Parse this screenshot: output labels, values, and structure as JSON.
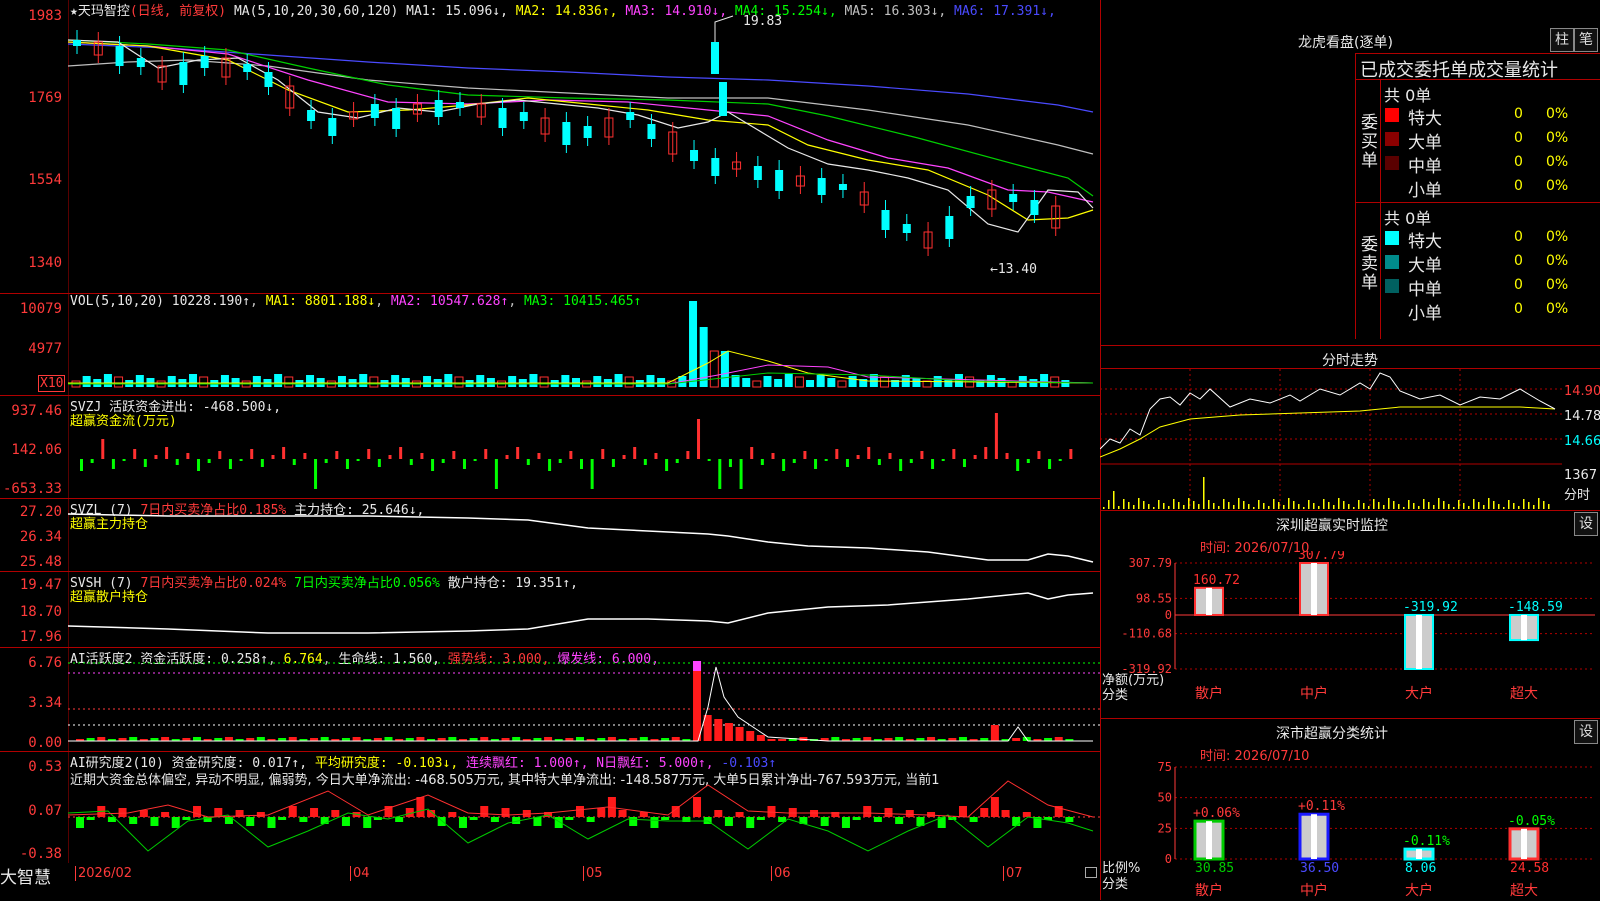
{
  "main": {
    "title_stock": "★天玛智控",
    "title_period": "(日线, 前复权)",
    "ma_label": "MA(5,10,20,30,60,120)",
    "ma_values": [
      {
        "name": "MA1",
        "value": "15.096↓",
        "color": "#e8e8e8"
      },
      {
        "name": "MA2",
        "value": "14.836↑",
        "color": "#ffff00"
      },
      {
        "name": "MA3",
        "value": "14.910↓",
        "color": "#ff44ff"
      },
      {
        "name": "MA4",
        "value": "15.254↓",
        "color": "#00ff00"
      },
      {
        "name": "MA5",
        "value": "16.303↓",
        "color": "#c0c0c0"
      },
      {
        "name": "MA6",
        "value": "17.391↓",
        "color": "#4a4aff"
      }
    ],
    "y_ticks": [
      "1983",
      "1769",
      "1554",
      "1340"
    ],
    "high_label": "19.83",
    "low_label": "←13.40"
  },
  "vol": {
    "label": "VOL(5,10,20)",
    "value": "10228.190↑",
    "ma1": "MA1: 8801.188↓",
    "ma2": "MA2: 10547.628↑",
    "ma3": "MA3: 10415.465↑",
    "y_ticks": [
      "10079",
      "4977"
    ],
    "unit": "X10"
  },
  "svzj": {
    "label": "SVZJ 活跃资金进出: -468.500↓,",
    "sub": "超赢资金流(万元)",
    "y_ticks": [
      "937.46",
      "142.06",
      "-653.33"
    ]
  },
  "svzl": {
    "label": "SVZL (7)",
    "part2": "7日内买卖净占比0.185%",
    "part3": "主力持仓: 25.646↓,",
    "sub": "超赢主力持仓",
    "y_ticks": [
      "27.20",
      "26.34",
      "25.48"
    ]
  },
  "svsh": {
    "label": "SVSH (7)",
    "part2": "7日内买卖净占比0.024%",
    "part3": "7日内买卖净占比0.056%",
    "part4": "散户持仓: 19.351↑,",
    "sub": "超赢散户持仓",
    "y_ticks": [
      "19.47",
      "18.70",
      "17.96"
    ]
  },
  "ai1": {
    "label": "AI活跃度2 资金活跃度: 0.258↑",
    "v2": "6.764",
    "v3": "生命线: 1.560,",
    "v4": "强势线: 3.000,",
    "v5": "爆发线: 6.000,",
    "y_ticks": [
      "6.76",
      "3.34",
      "0.00"
    ]
  },
  "ai2": {
    "label": "AI研究度2(10) 资金研究度: 0.017↑,",
    "v2": "平均研究度: -0.103↓,",
    "v3": "连续飘红: 1.000↑,",
    "v4": "N日飘红: 5.000↑,",
    "v5": "-0.103↑",
    "note": "近期大资金总体偏空, 异动不明显, 偏弱势, 今日大单净流出: -468.505万元, 其中特大单净流出: -148.587万元, 大单5日累计净出-767.593万元, 当前1",
    "y_ticks": [
      "0.53",
      "0.07",
      "-0.38"
    ]
  },
  "footer": {
    "brand": "大智慧",
    "dates": [
      "2026/02",
      "04",
      "05",
      "06",
      "07"
    ]
  },
  "right": {
    "dragon_title": "龙虎看盘(逐单)",
    "btn_bar": "柱",
    "btn_pen": "笔",
    "stats_title": "已成交委托单成交量统计",
    "buy_label": "委买单",
    "sell_label": "委卖单",
    "buy_total": "共 0单",
    "sell_total": "共 0单",
    "buy_rows": [
      {
        "name": "特大",
        "count": "0",
        "pct": "0%",
        "color": "#ff0000"
      },
      {
        "name": "大单",
        "count": "0",
        "pct": "0%",
        "color": "#8b0000"
      },
      {
        "name": "中单",
        "count": "0",
        "pct": "0%",
        "color": "#5a0000"
      },
      {
        "name": "小单",
        "count": "0",
        "pct": "0%",
        "color": "#000000"
      }
    ],
    "sell_rows": [
      {
        "name": "特大",
        "count": "0",
        "pct": "0%",
        "color": "#00ffff"
      },
      {
        "name": "大单",
        "count": "0",
        "pct": "0%",
        "color": "#008b8b"
      },
      {
        "name": "中单",
        "count": "0",
        "pct": "0%",
        "color": "#006060"
      },
      {
        "name": "小单",
        "count": "0",
        "pct": "0%",
        "color": "#000000"
      }
    ],
    "intraday_title": "分时走势",
    "intraday_ticks": [
      "14.90",
      "14.78",
      "14.66"
    ],
    "intraday_vol": "1367",
    "intraday_unit": "分时",
    "sz_title": "深圳超赢实时监控",
    "sz_btn": "设",
    "sz_time": "时间: 2026/07/10",
    "sz_ylabel": "净额(万元)",
    "sz_xlabel": "分类",
    "sz_ticks": [
      "307.79",
      "98.55",
      "0",
      "-110.68",
      "-319.92"
    ],
    "class_title": "深市超赢分类统计",
    "class_btn": "设",
    "class_time": "时间: 2026/07/10",
    "class_ylabel": "比例%",
    "class_xlabel": "分类",
    "class_ticks": [
      "75",
      "50",
      "25",
      "0"
    ]
  },
  "chart_data": [
    {
      "type": "bar",
      "title": "深圳超赢实时监控",
      "categories": [
        "散户",
        "中户",
        "大户",
        "超大"
      ],
      "values": [
        160.72,
        307.79,
        -319.92,
        -148.59
      ],
      "ylabel": "净额(万元)",
      "xlabel": "分类",
      "ylim": [
        -319.92,
        307.79
      ]
    },
    {
      "type": "bar",
      "title": "深市超赢分类统计",
      "categories": [
        "散户",
        "中户",
        "大户",
        "超大"
      ],
      "values": [
        30.85,
        36.5,
        8.06,
        24.58
      ],
      "changes": [
        "+0.06%",
        "+0.11%",
        "-0.11%",
        "-0.05%"
      ],
      "ylabel": "比例%",
      "xlabel": "分类",
      "ylim": [
        0,
        75
      ]
    }
  ]
}
